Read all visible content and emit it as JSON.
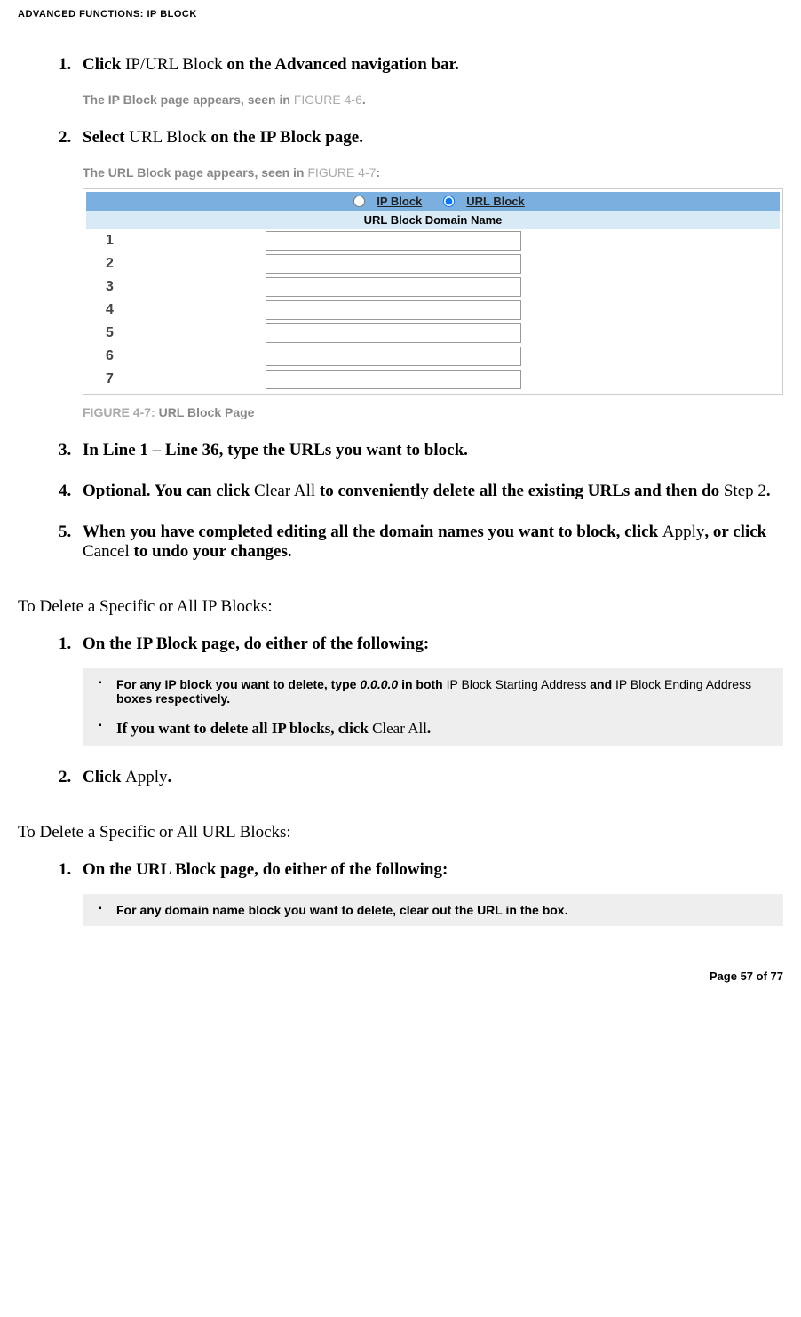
{
  "header": "ADVANCED FUNCTIONS: IP BLOCK",
  "steps_a": {
    "s1": {
      "prefix": "Click ",
      "mid": "IP/URL Block",
      "suffix": " on the Advanced navigation bar."
    },
    "s1_note_prefix": "The IP Block page appears, seen in ",
    "s1_note_figref": "FIGURE 4-6",
    "s1_note_suffix": ".",
    "s2": {
      "prefix": "Select ",
      "mid": "URL Block",
      "suffix": " on the IP Block page."
    },
    "s2_note_prefix": "The URL Block page appears, seen in ",
    "s2_note_figref": "FIGURE 4-7",
    "s2_note_suffix": ":",
    "s3": "In Line 1 – Line 36, type the URLs you want to block.",
    "s4": {
      "a": "Optional. You can click ",
      "b": "Clear All",
      "c": " to conveniently delete all the existing URLs and then do ",
      "d": "Step 2",
      "e": "."
    },
    "s5": {
      "a": "When you have completed editing all the domain names you want to block, click ",
      "b": "Apply",
      "c": ", or click ",
      "d": "Cancel",
      "e": " to undo your changes."
    }
  },
  "figure": {
    "ip_block_label": "IP Block",
    "url_block_label": "URL Block",
    "table_header": "URL Block Domain Name",
    "rows": [
      "1",
      "2",
      "3",
      "4",
      "5",
      "6",
      "7"
    ],
    "caption_prefix": "FIGURE 4-7: ",
    "caption_bold": "URL Block Page"
  },
  "section_b_title": "To Delete a Specific or All IP Blocks:",
  "steps_b": {
    "s1": "On the IP Block page, do either of the following:",
    "bullet1": {
      "a": "For any IP block you want to delete, type ",
      "b": "0.0.0.0",
      "c": " in both ",
      "d": "IP Block Starting Address",
      "e": " and ",
      "f": "IP Block Ending Address",
      "g": " boxes respectively."
    },
    "bullet2": {
      "a": "If you want to delete all IP blocks, click ",
      "b": "Clear All",
      "c": "."
    },
    "s2": {
      "a": "Click ",
      "b": "Apply",
      "c": "."
    }
  },
  "section_c_title": "To Delete a Specific or All URL Blocks:",
  "steps_c": {
    "s1": "On the URL Block page, do either of the following:",
    "bullet1": "For any domain name block you want to delete, clear out the URL in the box."
  },
  "footer": "Page 57 of 77"
}
